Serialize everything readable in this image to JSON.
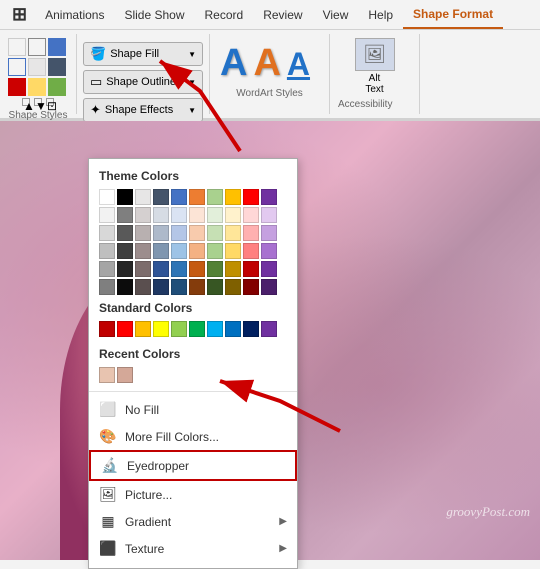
{
  "ribbon": {
    "tabs": [
      {
        "id": "home-icon",
        "label": "⊞",
        "isIcon": true
      },
      {
        "id": "animations",
        "label": "Animations"
      },
      {
        "id": "slideshow",
        "label": "Slide Show"
      },
      {
        "id": "record",
        "label": "Record"
      },
      {
        "id": "review",
        "label": "Review"
      },
      {
        "id": "view",
        "label": "View"
      },
      {
        "id": "help",
        "label": "Help"
      },
      {
        "id": "shape-format",
        "label": "Shape Format",
        "active": true
      }
    ],
    "shape_styles_label": "Shape Styles",
    "shape_fill_btn": "Shape Fill",
    "wordart_label": "WordArt Styles",
    "alt_text_label": "Alt\nText",
    "accessibility_label": "Accessibility"
  },
  "dropdown": {
    "theme_colors_title": "Theme Colors",
    "standard_colors_title": "Standard Colors",
    "recent_colors_title": "Recent Colors",
    "no_fill_label": "No Fill",
    "more_fill_label": "More Fill Colors...",
    "eyedropper_label": "Eyedropper",
    "picture_label": "Picture...",
    "gradient_label": "Gradient",
    "texture_label": "Texture",
    "theme_colors": [
      [
        "#ffffff",
        "#f2f2f2",
        "#d8d8d8",
        "#bfbfbf",
        "#a5a5a5",
        "#7f7f7f"
      ],
      [
        "#000000",
        "#7f7f7f",
        "#595959",
        "#3f3f3f",
        "#262626",
        "#0c0c0c"
      ],
      [
        "#e7e6e6",
        "#d5d0d0",
        "#b8b0b0",
        "#9c8d8d",
        "#7c6c6c",
        "#5a4f4f"
      ],
      [
        "#44546a",
        "#d6dce4",
        "#adb9ca",
        "#7f96b0",
        "#2f5496",
        "#1f3863"
      ],
      [
        "#4472c4",
        "#dae3f3",
        "#b4c6e7",
        "#9dc3e6",
        "#2e75b6",
        "#1f4e79"
      ],
      [
        "#ed7d31",
        "#fce4d6",
        "#f8cbad",
        "#f4b183",
        "#c55a11",
        "#843c0c"
      ],
      [
        "#a9d18e",
        "#e2efda",
        "#c6e0b4",
        "#a9d18e",
        "#538135",
        "#375623"
      ],
      [
        "#ffc000",
        "#fff2cc",
        "#ffe699",
        "#ffd966",
        "#bf8f00",
        "#7f6000"
      ],
      [
        "#ff0000",
        "#ffd7d7",
        "#ffb0b0",
        "#ff8080",
        "#c00000",
        "#820000"
      ],
      [
        "#7030a0",
        "#e2c9f0",
        "#c5a0e0",
        "#a871d0",
        "#7030a0",
        "#4b1f6b"
      ]
    ],
    "standard_colors": [
      "#c00000",
      "#ff0000",
      "#ffc000",
      "#ffff00",
      "#92d050",
      "#00b050",
      "#00b0f0",
      "#0070c0",
      "#002060",
      "#7030a0"
    ],
    "recent_colors": [
      "#e8c4b0",
      "#d4a898"
    ]
  },
  "watermark": "groovyPost.com"
}
